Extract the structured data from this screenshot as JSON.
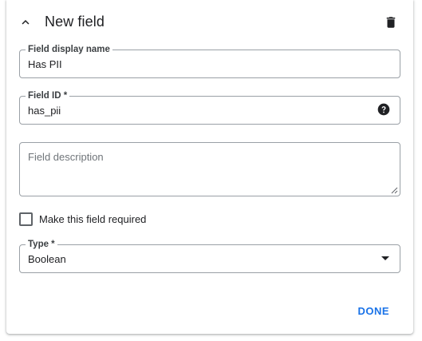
{
  "header": {
    "title": "New field",
    "collapse_icon": "chevron-up-icon",
    "delete_icon": "trash-icon"
  },
  "fields": {
    "display_name": {
      "label": "Field display name",
      "value": "Has PII"
    },
    "field_id": {
      "label": "Field ID *",
      "value": "has_pii",
      "help_icon": "help-circle-icon"
    },
    "description": {
      "placeholder": "Field description",
      "value": ""
    },
    "required": {
      "label": "Make this field required",
      "checked": false
    },
    "type": {
      "label": "Type *",
      "value": "Boolean",
      "dropdown_icon": "arrow-drop-down-icon"
    }
  },
  "footer": {
    "done_label": "DONE"
  },
  "colors": {
    "accent": "#1a73e8",
    "border": "#9aa0a6",
    "text": "#202124",
    "placeholder": "#70757a"
  }
}
